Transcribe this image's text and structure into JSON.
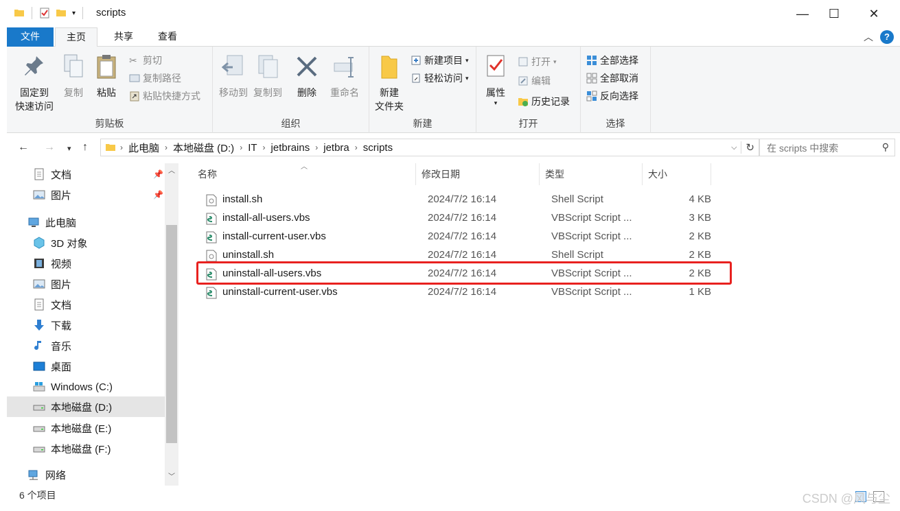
{
  "window": {
    "title": "scripts",
    "minimize": "—",
    "maximize": "☐",
    "close": "✕"
  },
  "tabs": {
    "file": "文件",
    "home": "主页",
    "share": "共享",
    "view": "查看",
    "collapse": "︿",
    "help": "?"
  },
  "ribbon": {
    "clipboard": {
      "label": "剪贴板",
      "pin": "固定到\n快速访问",
      "pin_line1": "固定到",
      "pin_line2": "快速访问",
      "copy": "复制",
      "paste": "粘贴",
      "cut": "剪切",
      "copy_path": "复制路径",
      "paste_shortcut": "粘贴快捷方式"
    },
    "organize": {
      "label": "组织",
      "move_to": "移动到",
      "copy_to": "复制到",
      "delete": "删除",
      "rename": "重命名"
    },
    "new": {
      "label": "新建",
      "new_folder_line1": "新建",
      "new_folder_line2": "文件夹",
      "new_item": "新建项目",
      "easy_access": "轻松访问"
    },
    "open": {
      "label": "打开",
      "properties": "属性",
      "open": "打开",
      "edit": "编辑",
      "history": "历史记录"
    },
    "select": {
      "label": "选择",
      "select_all": "全部选择",
      "select_none": "全部取消",
      "invert": "反向选择"
    }
  },
  "address": {
    "crumbs": [
      "此电脑",
      "本地磁盘 (D:)",
      "IT",
      "jetbrains",
      "jetbra",
      "scripts"
    ],
    "search_placeholder": "在 scripts 中搜索"
  },
  "nav": {
    "quick": [
      {
        "label": "文档"
      },
      {
        "label": "图片"
      }
    ],
    "this_pc": "此电脑",
    "pc_items": [
      {
        "label": "3D 对象"
      },
      {
        "label": "视频"
      },
      {
        "label": "图片"
      },
      {
        "label": "文档"
      },
      {
        "label": "下载"
      },
      {
        "label": "音乐"
      },
      {
        "label": "桌面"
      },
      {
        "label": "Windows (C:)"
      },
      {
        "label": "本地磁盘 (D:)"
      },
      {
        "label": "本地磁盘 (E:)"
      },
      {
        "label": "本地磁盘 (F:)"
      }
    ],
    "network": "网络"
  },
  "columns": {
    "name": "名称",
    "date": "修改日期",
    "type": "类型",
    "size": "大小"
  },
  "files": [
    {
      "name": "install.sh",
      "date": "2024/7/2 16:14",
      "type": "Shell Script",
      "size": "4 KB",
      "kind": "sh"
    },
    {
      "name": "install-all-users.vbs",
      "date": "2024/7/2 16:14",
      "type": "VBScript Script ...",
      "size": "3 KB",
      "kind": "vbs"
    },
    {
      "name": "install-current-user.vbs",
      "date": "2024/7/2 16:14",
      "type": "VBScript Script ...",
      "size": "2 KB",
      "kind": "vbs"
    },
    {
      "name": "uninstall.sh",
      "date": "2024/7/2 16:14",
      "type": "Shell Script",
      "size": "2 KB",
      "kind": "sh"
    },
    {
      "name": "uninstall-all-users.vbs",
      "date": "2024/7/2 16:14",
      "type": "VBScript Script ...",
      "size": "2 KB",
      "kind": "vbs"
    },
    {
      "name": "uninstall-current-user.vbs",
      "date": "2024/7/2 16:14",
      "type": "VBScript Script ...",
      "size": "1 KB",
      "kind": "vbs"
    }
  ],
  "status": {
    "count": "6 个项目"
  },
  "watermark": "CSDN @风与尘",
  "colors": {
    "accent": "#1979ca",
    "highlight": "#e8211f",
    "selected_nav": "#e5e5e5"
  }
}
